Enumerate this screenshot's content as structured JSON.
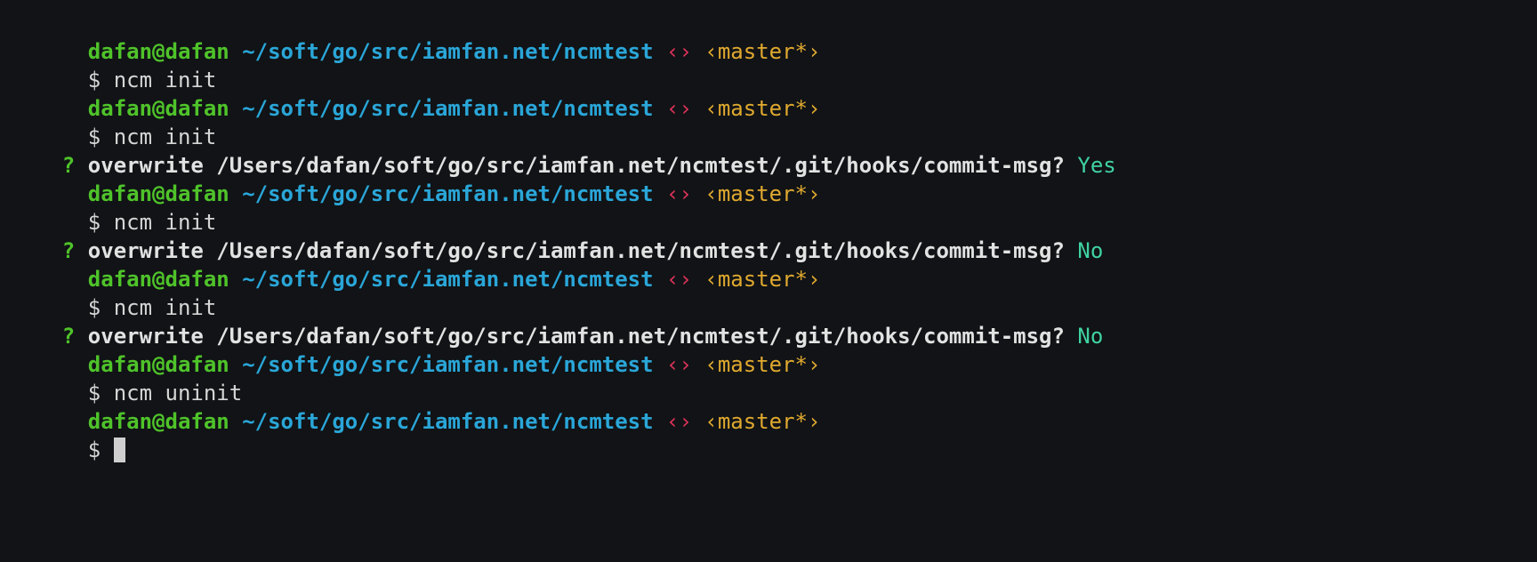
{
  "colors": {
    "background": "#111316",
    "user": "#4fc32a",
    "path": "#2aa6d8",
    "vcs_marker": "#e0335a",
    "branch": "#e0a92f",
    "text": "#d6d6d6",
    "answer": "#3fd3a1"
  },
  "prompt": {
    "user": "dafan@dafan",
    "path": "~/soft/go/src/iamfan.net/ncmtest",
    "vcs_marker": "‹›",
    "branch": "‹master*›",
    "symbol": "$"
  },
  "session": [
    {
      "command": "ncm init"
    },
    {
      "command": "ncm init",
      "question_mark": "?",
      "question": "overwrite /Users/dafan/soft/go/src/iamfan.net/ncmtest/.git/hooks/commit-msg?",
      "answer": "Yes"
    },
    {
      "command": "ncm init",
      "question_mark": "?",
      "question": "overwrite /Users/dafan/soft/go/src/iamfan.net/ncmtest/.git/hooks/commit-msg?",
      "answer": "No"
    },
    {
      "command": "ncm init",
      "question_mark": "?",
      "question": "overwrite /Users/dafan/soft/go/src/iamfan.net/ncmtest/.git/hooks/commit-msg?",
      "answer": "No"
    },
    {
      "command": "ncm uninit"
    },
    {
      "command": ""
    }
  ]
}
